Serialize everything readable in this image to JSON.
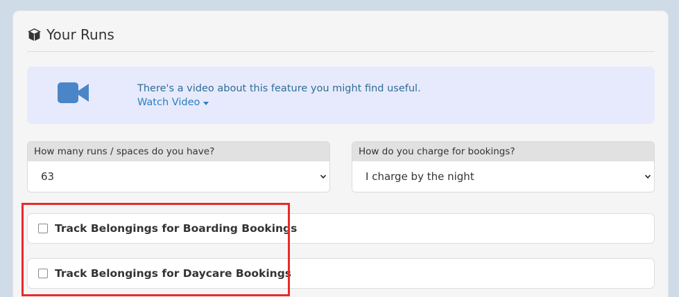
{
  "card": {
    "title": "Your Runs",
    "title_icon": "cube-icon"
  },
  "video_notice": {
    "icon": "video-camera-icon",
    "icon_color": "#4a86c7",
    "text": "There's a video about this feature you might find useful.",
    "link_label": "Watch Video"
  },
  "runs_field": {
    "label": "How many runs / spaces do you have?",
    "value": "63"
  },
  "charge_field": {
    "label": "How do you charge for bookings?",
    "value": "I charge by the night"
  },
  "options": [
    {
      "label": "Track Belongings for Boarding Bookings",
      "checked": false
    },
    {
      "label": "Track Belongings for Daycare Bookings",
      "checked": false
    }
  ],
  "colors": {
    "background": "#cfdbe6",
    "link": "#2a7fc0",
    "highlight": "#e8292a"
  }
}
